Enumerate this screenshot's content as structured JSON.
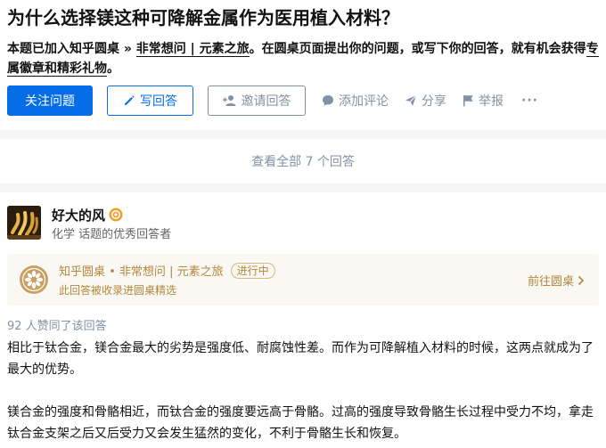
{
  "question": {
    "title": "为什么选择镁这种可降解金属作为医用植入材料？",
    "notice_prefix": "本题已加入知乎圆桌 » ",
    "notice_link": "非常想问 | 元素之旅",
    "notice_mid": "。在圆桌页面提出你的问题，或写下你的回答，就有机会获得",
    "notice_link2": "专属徽章和精彩礼物",
    "notice_end": "。"
  },
  "actions": {
    "follow": "关注问题",
    "write": "写回答",
    "invite": "邀请回答",
    "comment": "添加评论",
    "share": "分享",
    "report": "举报",
    "more": "···"
  },
  "view_all": "查看全部 7 个回答",
  "answer": {
    "author_name": "好大的风",
    "author_headline": "化学 话题的优秀回答者",
    "roundtable": {
      "title": "知乎圆桌 • 非常想问 | 元素之旅",
      "status": "进行中",
      "subtitle": "此回答被收录进圆桌精选",
      "goto": "前往圆桌"
    },
    "upvotes": "92 人赞同了该回答",
    "paragraphs": [
      "相比于钛合金，镁合金最大的劣势是强度低、耐腐蚀性差。而作为可降解植入材料的时候，这两点就成为了最大的优势。",
      "镁合金的强度和骨骼相近，而钛合金的强度要远高于骨骼。过高的强度导致骨骼生长过程中受力不均，拿走钛合金支架之后又后受力又会发生猛然的变化，不利于骨骼生长和恢复。"
    ]
  },
  "colors": {
    "primary": "#056de8",
    "gray": "#8590a6",
    "gold": "#b3863d",
    "band": "#f6f6f6"
  },
  "icons": [
    "pencil-icon",
    "invite-user-icon",
    "comment-icon",
    "share-icon",
    "flag-icon",
    "verified-badge-icon",
    "roundtable-logo-icon",
    "chevron-right-icon"
  ]
}
